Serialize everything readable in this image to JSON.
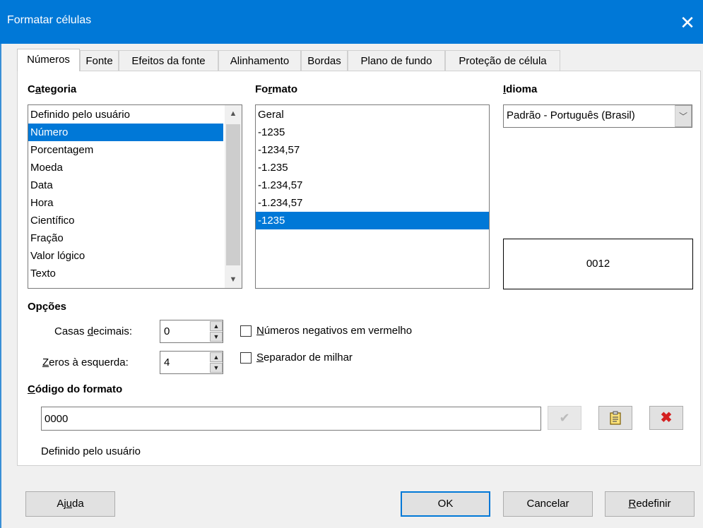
{
  "window": {
    "title": "Formatar células"
  },
  "tabs": [
    {
      "label": "Números"
    },
    {
      "label": "Fonte"
    },
    {
      "label": "Efeitos da fonte"
    },
    {
      "label": "Alinhamento"
    },
    {
      "label": "Bordas"
    },
    {
      "label": "Plano de fundo"
    },
    {
      "label": "Proteção de célula"
    }
  ],
  "category": {
    "heading_pre": "C",
    "heading_ul": "a",
    "heading_post": "tegoria",
    "items": [
      "Definido pelo usuário",
      "Número",
      "Porcentagem",
      "Moeda",
      "Data",
      "Hora",
      "Científico",
      "Fração",
      "Valor lógico",
      "Texto"
    ],
    "selected": "Número"
  },
  "format": {
    "heading_pre": "Fo",
    "heading_ul": "r",
    "heading_post": "mato",
    "items": [
      "Geral",
      "-1235",
      "-1234,57",
      "-1.235",
      "-1.234,57",
      "-1.234,57",
      "-1235"
    ],
    "selected_index": 6
  },
  "language": {
    "heading_pre": "",
    "heading_ul": "I",
    "heading_post": "dioma",
    "value": "Padrão - Português (Brasil)"
  },
  "preview": {
    "value": "0012"
  },
  "options": {
    "heading": "Opções",
    "decimal_pre": "Casas ",
    "decimal_ul": "d",
    "decimal_post": "ecimais:",
    "decimal_value": "0",
    "leading_pre": "",
    "leading_ul": "Z",
    "leading_post": "eros à esquerda:",
    "leading_value": "4",
    "negative_ul": "N",
    "negative_post": "úmeros negativos em vermelho",
    "thousands_ul": "S",
    "thousands_post": "eparador de milhar"
  },
  "format_code": {
    "heading_pre": "",
    "heading_ul": "C",
    "heading_post": "ódigo do formato",
    "value": "0000",
    "description": "Definido pelo usuário"
  },
  "buttons": {
    "help_pre": "Aj",
    "help_ul": "u",
    "help_post": "da",
    "ok": "OK",
    "cancel": "Cancelar",
    "reset_pre": "",
    "reset_ul": "R",
    "reset_post": "edefinir"
  },
  "icons": {
    "close": "close-icon",
    "accept": "check-icon",
    "comment": "note-icon",
    "delete": "delete-icon"
  },
  "colors": {
    "accent": "#0078d7",
    "delete": "#d42020"
  }
}
